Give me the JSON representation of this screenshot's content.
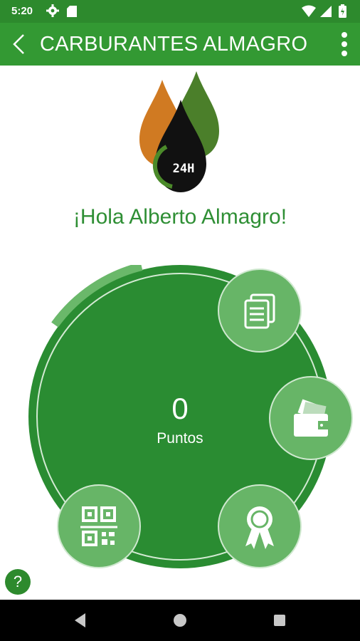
{
  "status_bar": {
    "time": "5:20",
    "background": "#2d8a2d"
  },
  "app_bar": {
    "title": "CARBURANTES ALMAGRO",
    "background": "#339933",
    "back_icon": "chevron-left-icon",
    "menu_icon": "more-vert-icon"
  },
  "logo": {
    "badge_text": "24H",
    "drop_colors": [
      "#d07a22",
      "#4b7f2a",
      "#111111"
    ]
  },
  "greeting": "¡Hola Alberto Almagro!",
  "points": {
    "value": "0",
    "label": "Puntos"
  },
  "actions": [
    {
      "name": "documents",
      "icon": "documents-icon"
    },
    {
      "name": "wallet",
      "icon": "wallet-icon"
    },
    {
      "name": "award",
      "icon": "award-ribbon-icon"
    },
    {
      "name": "qr-code",
      "icon": "qr-code-icon"
    }
  ],
  "help": {
    "label": "?"
  },
  "colors": {
    "primary": "#339933",
    "dial": "#2a8c32",
    "dial_ring": "#6ab86a",
    "button": "#67b567",
    "greeting": "#2f8f35"
  }
}
